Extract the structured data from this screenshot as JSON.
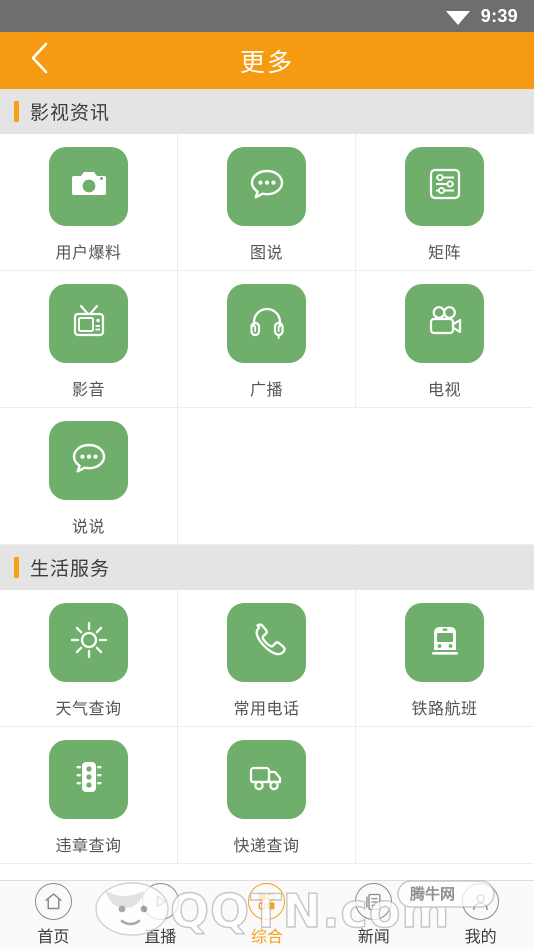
{
  "statusbar": {
    "time": "9:39",
    "wifi_icon": "wifi-icon"
  },
  "header": {
    "title": "更多",
    "back_icon": "back-chevron-icon",
    "accent_color": "#f59a11"
  },
  "theme": {
    "tile_green": "#6faf6b",
    "accent_orange": "#f5a11a",
    "section_bg": "#e4e4e4",
    "divider": "#ededed"
  },
  "sections": [
    {
      "title": "影视资讯",
      "items": [
        {
          "label": "用户爆料",
          "icon": "camera-icon"
        },
        {
          "label": "图说",
          "icon": "chat-bubble-dots-icon"
        },
        {
          "label": "矩阵",
          "icon": "sliders-panel-icon"
        },
        {
          "label": "影音",
          "icon": "retro-tv-icon"
        },
        {
          "label": "广播",
          "icon": "headphones-icon"
        },
        {
          "label": "电视",
          "icon": "movie-camera-icon"
        },
        {
          "label": "说说",
          "icon": "chat-bubble-dots-icon"
        }
      ]
    },
    {
      "title": "生活服务",
      "items": [
        {
          "label": "天气查询",
          "icon": "sun-icon"
        },
        {
          "label": "常用电话",
          "icon": "phone-handset-icon"
        },
        {
          "label": "铁路航班",
          "icon": "train-icon"
        },
        {
          "label": "违章查询",
          "icon": "traffic-light-icon"
        },
        {
          "label": "快递查询",
          "icon": "delivery-truck-icon"
        }
      ]
    }
  ],
  "bottom_nav": {
    "active_index": 2,
    "items": [
      {
        "label": "首页",
        "icon": "home-icon"
      },
      {
        "label": "直播",
        "icon": "play-icon"
      },
      {
        "label": "综合",
        "icon": "grid-squares-icon"
      },
      {
        "label": "新闻",
        "icon": "document-icon"
      },
      {
        "label": "我的",
        "icon": "person-icon"
      }
    ]
  },
  "watermark": {
    "site": "QQTN.com",
    "badge": "腾牛网"
  }
}
